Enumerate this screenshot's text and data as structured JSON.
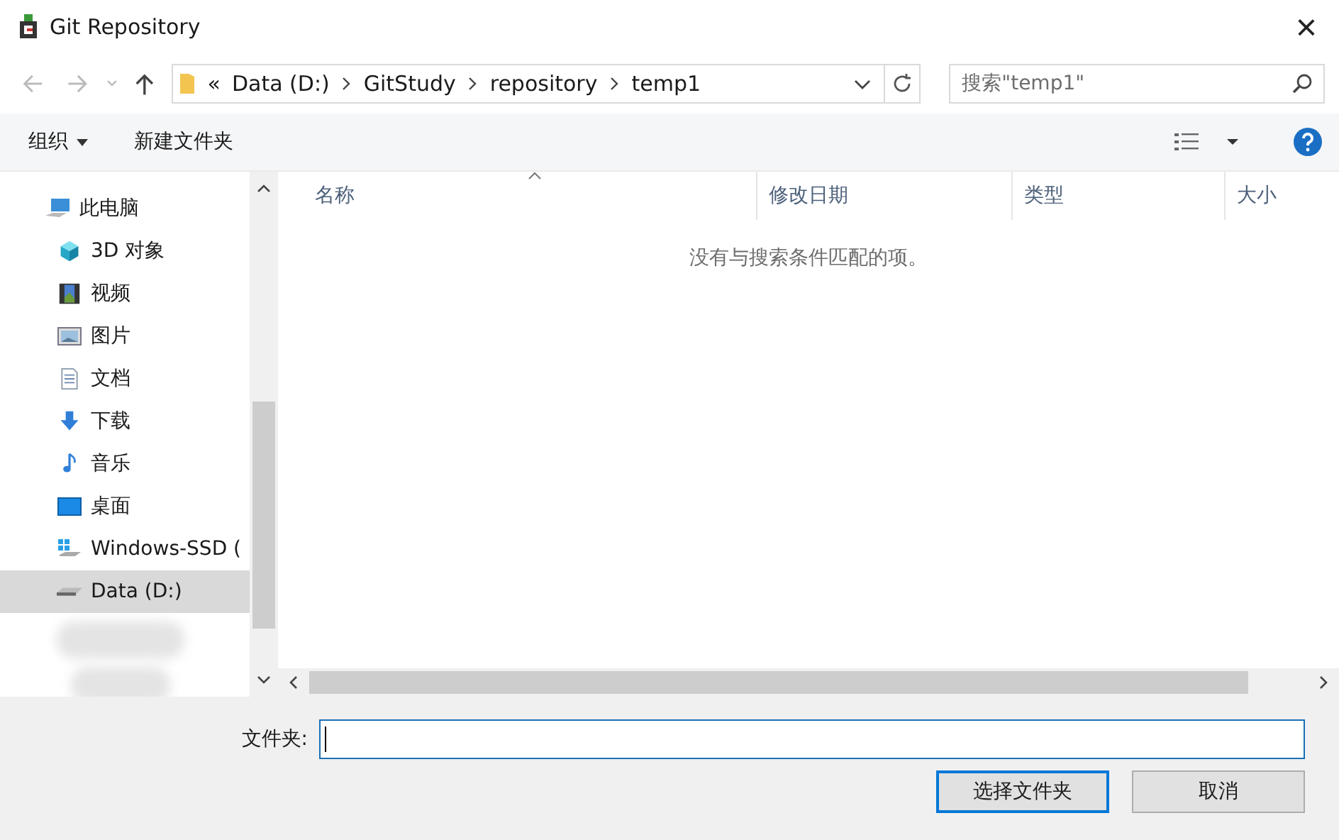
{
  "window": {
    "title": "Git Repository",
    "close": "×"
  },
  "address_bar": {
    "overflow": "«",
    "path": [
      "Data (D:)",
      "GitStudy",
      "repository",
      "temp1"
    ]
  },
  "search": {
    "placeholder": "搜索\"temp1\""
  },
  "toolbar": {
    "organize": "组织",
    "new_folder": "新建文件夹"
  },
  "sidebar": {
    "items": [
      {
        "label": "此电脑",
        "kind": "pc",
        "selected": false,
        "children": [
          {
            "label": "3D 对象",
            "kind": "cube",
            "selected": false
          },
          {
            "label": "视频",
            "kind": "video",
            "selected": false
          },
          {
            "label": "图片",
            "kind": "image",
            "selected": false
          },
          {
            "label": "文档",
            "kind": "doc",
            "selected": false
          },
          {
            "label": "下载",
            "kind": "download",
            "selected": false
          },
          {
            "label": "音乐",
            "kind": "music",
            "selected": false
          },
          {
            "label": "桌面",
            "kind": "desktop",
            "selected": false
          },
          {
            "label": "Windows-SSD (",
            "kind": "winDrive",
            "selected": false
          },
          {
            "label": "Data (D:)",
            "kind": "drive",
            "selected": true
          }
        ]
      }
    ]
  },
  "table": {
    "columns": [
      "名称",
      "修改日期",
      "类型",
      "大小"
    ],
    "empty_message": "没有与搜索条件匹配的项。"
  },
  "folder_field": {
    "label": "文件夹:"
  },
  "buttons": [
    "选择文件夹",
    "取消"
  ]
}
